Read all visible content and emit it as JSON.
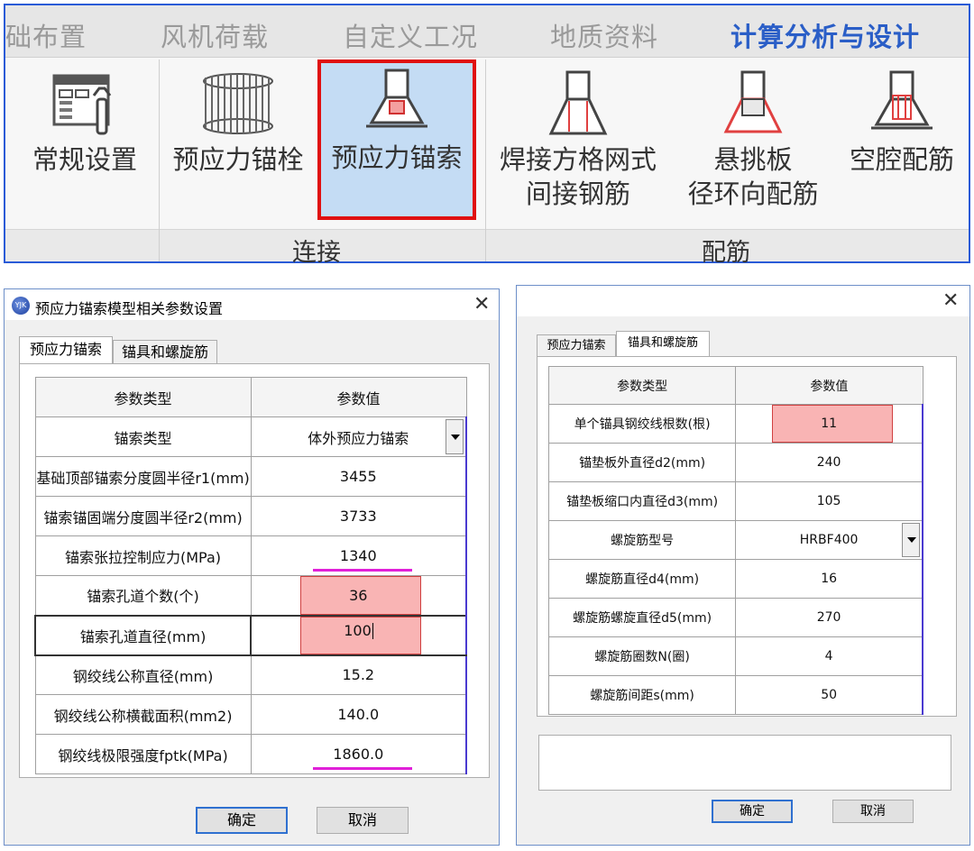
{
  "ribbon": {
    "tabs": [
      "础布置",
      "风机荷载",
      "自定义工况",
      "地质资料",
      "计算分析与设计"
    ],
    "active_tab": "计算分析与设计",
    "buttons": [
      {
        "label": "常规设置",
        "icon": "settings-window-wrench-icon"
      },
      {
        "label": "预应力锚栓",
        "icon": "anchor-bolt-cage-icon"
      },
      {
        "label": "预应力锚索",
        "icon": "anchor-cable-icon",
        "selected": true
      },
      {
        "label1": "焊接方格网式",
        "label2": "间接钢筋",
        "icon": "welded-mesh-rebar-icon"
      },
      {
        "label1": "悬挑板",
        "label2": "径环向配筋",
        "icon": "cantilever-plate-rebar-icon"
      },
      {
        "label": "空腔配筋",
        "icon": "cavity-rebar-icon"
      }
    ],
    "groups": [
      "连接",
      "配筋"
    ],
    "highlight_color": "#e01010"
  },
  "dialog_left": {
    "title": "预应力锚索模型相关参数设置",
    "tabs": [
      "预应力锚索",
      "锚具和螺旋筋"
    ],
    "active_tab": "预应力锚索",
    "header": [
      "参数类型",
      "参数值"
    ],
    "rows": [
      {
        "label": "锚索类型",
        "value": "体外预应力锚索",
        "dropdown": true
      },
      {
        "label": "基础顶部锚索分度圆半径r1(mm)",
        "value": "3455"
      },
      {
        "label": "锚索锚固端分度圆半径r2(mm)",
        "value": "3733"
      },
      {
        "label": "锚索张拉控制应力(MPa)",
        "value": "1340",
        "underline": true
      },
      {
        "label": "锚索孔道个数(个)",
        "value": "36",
        "highlight": true
      },
      {
        "label": "锚索孔道直径(mm)",
        "value": "100",
        "highlight": true,
        "editing": true
      },
      {
        "label": "钢绞线公称直径(mm)",
        "value": "15.2"
      },
      {
        "label": "钢绞线公称横截面积(mm2)",
        "value": "140.0"
      },
      {
        "label": "钢绞线极限强度fptk(MPa)",
        "value": "1860.0",
        "underline": true
      }
    ],
    "ok": "确定",
    "cancel": "取消"
  },
  "dialog_right": {
    "tabs": [
      "预应力锚索",
      "锚具和螺旋筋"
    ],
    "active_tab": "锚具和螺旋筋",
    "header": [
      "参数类型",
      "参数值"
    ],
    "rows": [
      {
        "label": "单个锚具钢绞线根数(根)",
        "value": "11",
        "highlight": true
      },
      {
        "label": "锚垫板外直径d2(mm)",
        "value": "240"
      },
      {
        "label": "锚垫板缩口内直径d3(mm)",
        "value": "105"
      },
      {
        "label": "螺旋筋型号",
        "value": "HRBF400",
        "dropdown": true
      },
      {
        "label": "螺旋筋直径d4(mm)",
        "value": "16"
      },
      {
        "label": "螺旋筋螺旋直径d5(mm)",
        "value": "270"
      },
      {
        "label": "螺旋筋圈数N(圈)",
        "value": "4"
      },
      {
        "label": "螺旋筋间距s(mm)",
        "value": "50"
      }
    ],
    "ok": "确定",
    "cancel": "取消"
  }
}
